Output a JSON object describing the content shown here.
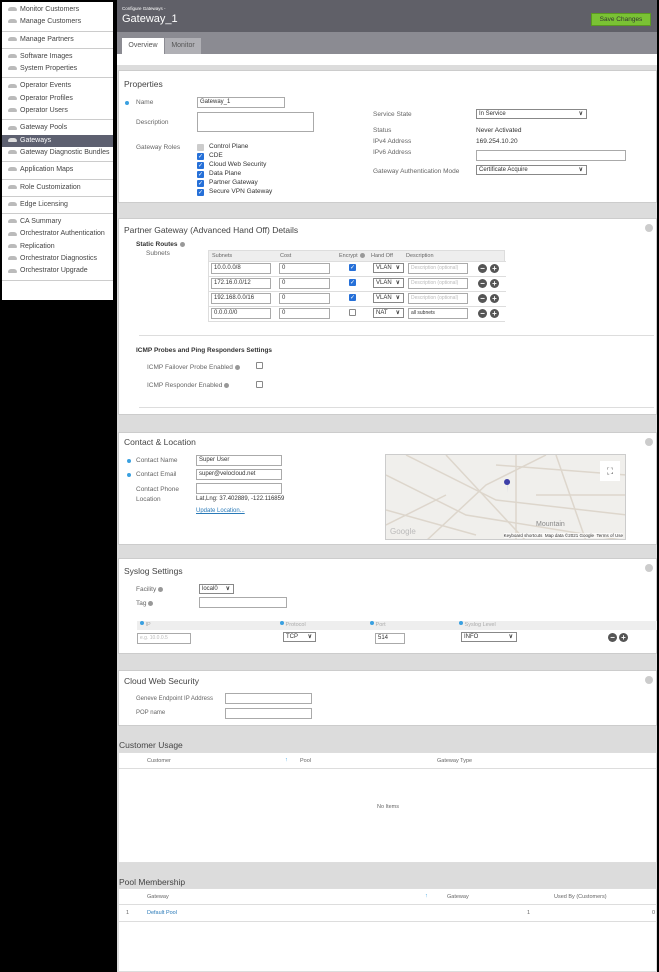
{
  "sidebar": {
    "groups": [
      [
        "Monitor Customers",
        "Manage Customers"
      ],
      [
        "Manage Partners"
      ],
      [
        "Software Images",
        "System Properties"
      ],
      [
        "Operator Events",
        "Operator Profiles",
        "Operator Users"
      ],
      [
        "Gateway Pools",
        "Gateways",
        "Gateway Diagnostic Bundles"
      ],
      [
        "Application Maps"
      ],
      [
        "Role Customization"
      ],
      [
        "Edge Licensing"
      ],
      [
        "CA Summary",
        "Orchestrator Authentication",
        "Replication",
        "Orchestrator Diagnostics",
        "Orchestrator Upgrade"
      ]
    ],
    "active": "Gateways"
  },
  "header": {
    "breadcrumb": "Configure Gateways -",
    "title": "Gateway_1",
    "save_label": "Save Changes"
  },
  "tabs": [
    {
      "label": "Overview",
      "active": true
    },
    {
      "label": "Monitor",
      "active": false
    }
  ],
  "properties": {
    "title": "Properties",
    "name_label": "Name",
    "name_value": "Gateway_1",
    "description_label": "Description",
    "description_value": "",
    "roles_label": "Gateway Roles",
    "roles": [
      {
        "label": "Control Plane",
        "checked": true,
        "disabled": true
      },
      {
        "label": "CDE",
        "checked": true
      },
      {
        "label": "Cloud Web Security",
        "checked": true
      },
      {
        "label": "Data Plane",
        "checked": true
      },
      {
        "label": "Partner Gateway",
        "checked": true
      },
      {
        "label": "Secure VPN Gateway",
        "checked": true
      }
    ],
    "service_state_label": "Service State",
    "service_state": "In Service",
    "status_label": "Status",
    "status": "Never Activated",
    "ipv4_label": "IPv4 Address",
    "ipv4": "169.254.10.20",
    "ipv6_label": "IPv6 Address",
    "ipv6": "",
    "auth_mode_label": "Gateway Authentication Mode",
    "auth_mode": "Certificate Acquire"
  },
  "partner": {
    "title": "Partner Gateway (Advanced Hand Off) Details",
    "static_routes_label": "Static Routes",
    "subnets_label": "Subnets",
    "columns": [
      "Subnets",
      "Cost",
      "Encrypt",
      "Hand Off",
      "Description"
    ],
    "rows": [
      {
        "subnet": "10.0.0.0/8",
        "cost": "0",
        "encrypt": true,
        "handoff": "VLAN",
        "description": ""
      },
      {
        "subnet": "172.16.0.0/12",
        "cost": "0",
        "encrypt": true,
        "handoff": "VLAN",
        "description": ""
      },
      {
        "subnet": "192.168.0.0/16",
        "cost": "0",
        "encrypt": true,
        "handoff": "VLAN",
        "description": ""
      },
      {
        "subnet": "0.0.0.0/0",
        "cost": "0",
        "encrypt": false,
        "handoff": "NAT",
        "description": "all subnets"
      }
    ],
    "description_placeholder": "Description (optional)",
    "icmp_title": "ICMP Probes and Ping Responders Settings",
    "icmp_probe_label": "ICMP Failover Probe Enabled",
    "icmp_probe": false,
    "icmp_responder_label": "ICMP Responder Enabled",
    "icmp_responder": false
  },
  "contact": {
    "title": "Contact & Location",
    "name_label": "Contact Name",
    "name": "Super User",
    "email_label": "Contact Email",
    "email": "super@velocloud.net",
    "phone_label": "Contact Phone",
    "phone": "",
    "location_label": "Location",
    "location": "Lat,Lng: 37.402889, -122.116859",
    "update_link": "Update Location...",
    "map": {
      "place_label": "Mountain",
      "logo": "Google",
      "keyboard": "Keyboard shortcuts",
      "mapdata": "Map data ©2021 Google",
      "terms": "Terms of Use"
    }
  },
  "syslog": {
    "title": "Syslog Settings",
    "facility_label": "Facility",
    "facility": "local0",
    "tag_label": "Tag",
    "tag": "",
    "columns": [
      "IP",
      "Protocol",
      "Port",
      "Syslog Level"
    ],
    "ip_placeholder": "e.g. 10.0.0.5",
    "protocol": "TCP",
    "port": "514",
    "level": "INFO"
  },
  "cws": {
    "title": "Cloud Web Security",
    "geneve_label": "Geneve Endpoint IP Address",
    "geneve": "",
    "pop_label": "POP name",
    "pop": ""
  },
  "customer_usage": {
    "title": "Customer Usage",
    "columns": [
      "Customer",
      "Pool",
      "Gateway Type"
    ],
    "empty": "No Items"
  },
  "pool_membership": {
    "title": "Pool Membership",
    "columns": [
      "Gateway",
      "Gateway",
      "Used By (Customers)"
    ],
    "rows": [
      {
        "index": "1",
        "name": "Default Pool",
        "gateways": "1",
        "used_by": "0"
      }
    ]
  },
  "colors": {
    "accent": "#3aa0e0",
    "save": "#7ac234",
    "header": "#606068",
    "sidebar_active": "#5d6070"
  }
}
